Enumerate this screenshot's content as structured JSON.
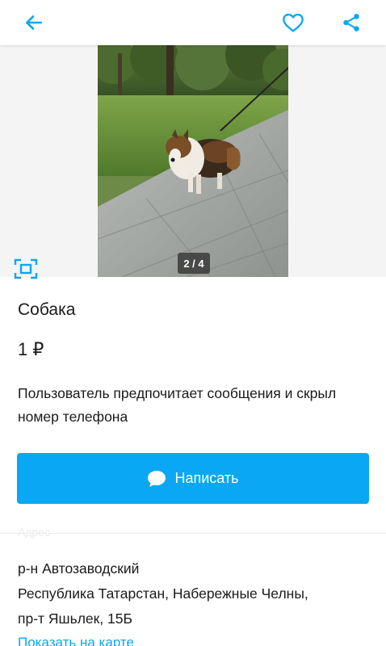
{
  "header": {
    "back_icon": "arrow-left-icon",
    "favorite_icon": "heart-outline-icon",
    "share_icon": "share-icon",
    "accent": "#0aa7f5"
  },
  "gallery": {
    "counter": "2 / 4",
    "fullscreen_icon": "fullscreen-icon",
    "background": "#f4f4f4"
  },
  "listing": {
    "title": "Собака",
    "price": "1 ₽",
    "contact_notice": "Пользователь предпочитает сообщения и скрыл номер телефона"
  },
  "actions": {
    "write_label": "Написать",
    "write_icon": "chat-bubble-icon",
    "button_color": "#0aa7f5"
  },
  "section": {
    "faded_label": "Адрес"
  },
  "location": {
    "district": "р-н Автозаводский",
    "city_line": "Республика Татарстан, Набережные Челны,",
    "street_line": "пр-т Яшьлек, 15Б",
    "map_link": "Показать на карте"
  }
}
